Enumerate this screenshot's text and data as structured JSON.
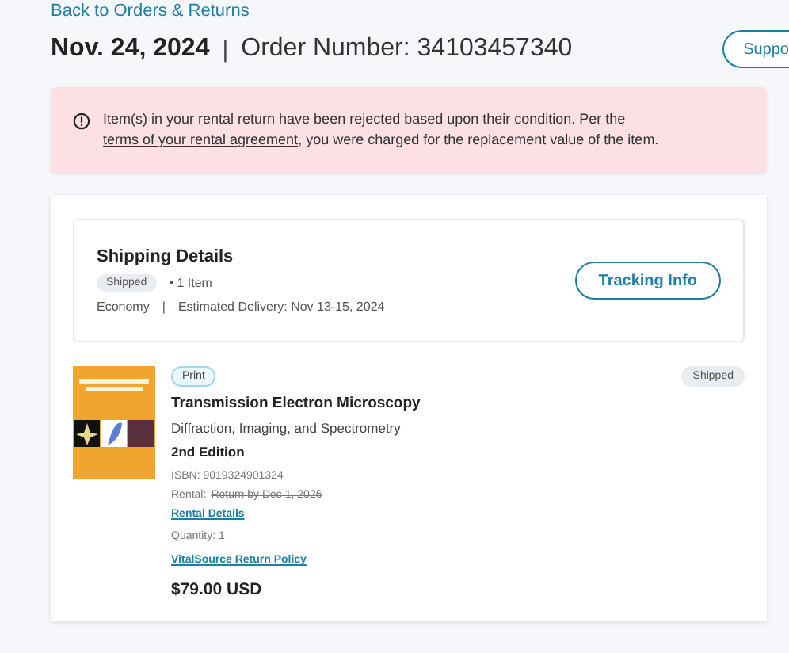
{
  "back_link": "Back to Orders & Returns",
  "order": {
    "date": "Nov. 24, 2024",
    "separator": "|",
    "number": "Order Number: 34103457340",
    "support_button": "Suppo"
  },
  "alert": {
    "text": "Item(s) in your rental return have been rejected based upon their condition. Per the",
    "link": "terms of your rental agreement",
    "text_after": ", you were charged for the replacement value of the item."
  },
  "shipping": {
    "title": "Shipping Details",
    "status": "Shipped",
    "count": "• 1 Item",
    "method": "Economy",
    "separator": "|",
    "delivery": "Estimated Delivery: Nov 13-15, 2024",
    "tracking_button": "Tracking Info"
  },
  "item": {
    "format": "Print",
    "status": "Shipped",
    "title": "Transmission Electron Microscopy",
    "subtitle": "Diffraction, Imaging, and Spectrometry",
    "edition": "2nd Edition",
    "isbn": "ISBN: 9019324901324",
    "rental_label": "Rental:",
    "rental_return": "Return by Dec 1, 2026",
    "rental_details": "Rental Details",
    "quantity": "Quantity: 1",
    "return_policy": "VitalSource Return Policy",
    "price": "$79.00 USD"
  }
}
